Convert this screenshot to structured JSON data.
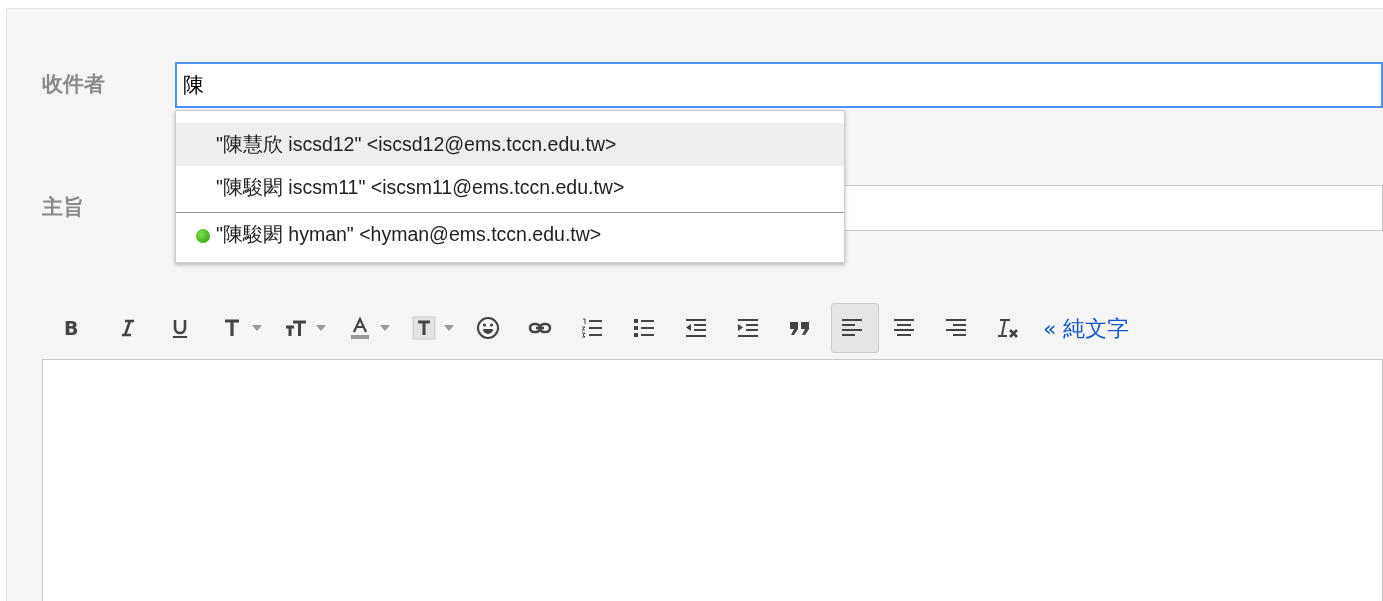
{
  "to": {
    "label": "收件者",
    "value": "陳"
  },
  "suggestions": [
    {
      "text": "\"陳慧欣 iscsd12\" <iscsd12@ems.tccn.edu.tw>",
      "selected": true,
      "online": false,
      "separated": false
    },
    {
      "text": "\"陳駿閎 iscsm11\" <iscsm11@ems.tccn.edu.tw>",
      "selected": false,
      "online": false,
      "separated": false
    },
    {
      "text": "\"陳駿閎 hyman\" <hyman@ems.tccn.edu.tw>",
      "selected": false,
      "online": true,
      "separated": true
    }
  ],
  "subject": {
    "label": "主旨"
  },
  "toolbar": [
    {
      "kind": "bold",
      "label": "B",
      "caret": false,
      "selected": false
    },
    {
      "kind": "italic",
      "caret": false,
      "selected": false
    },
    {
      "kind": "underline",
      "caret": false,
      "selected": false
    },
    {
      "kind": "font",
      "caret": true,
      "selected": false
    },
    {
      "kind": "size",
      "caret": true,
      "selected": false
    },
    {
      "kind": "color",
      "caret": true,
      "selected": false
    },
    {
      "kind": "highlight",
      "caret": true,
      "selected": false
    },
    {
      "kind": "emoji",
      "caret": false,
      "selected": false
    },
    {
      "kind": "link",
      "caret": false,
      "selected": false
    },
    {
      "kind": "numbered",
      "caret": false,
      "selected": false
    },
    {
      "kind": "bulleted",
      "caret": false,
      "selected": false
    },
    {
      "kind": "outdent",
      "caret": false,
      "selected": false
    },
    {
      "kind": "indent",
      "caret": false,
      "selected": false
    },
    {
      "kind": "quote",
      "caret": false,
      "selected": false
    },
    {
      "kind": "align-left",
      "caret": false,
      "selected": true
    },
    {
      "kind": "align-center",
      "caret": false,
      "selected": false
    },
    {
      "kind": "align-right",
      "caret": false,
      "selected": false
    },
    {
      "kind": "clear",
      "caret": false,
      "selected": false
    }
  ],
  "plain_text_link": "« 純文字"
}
